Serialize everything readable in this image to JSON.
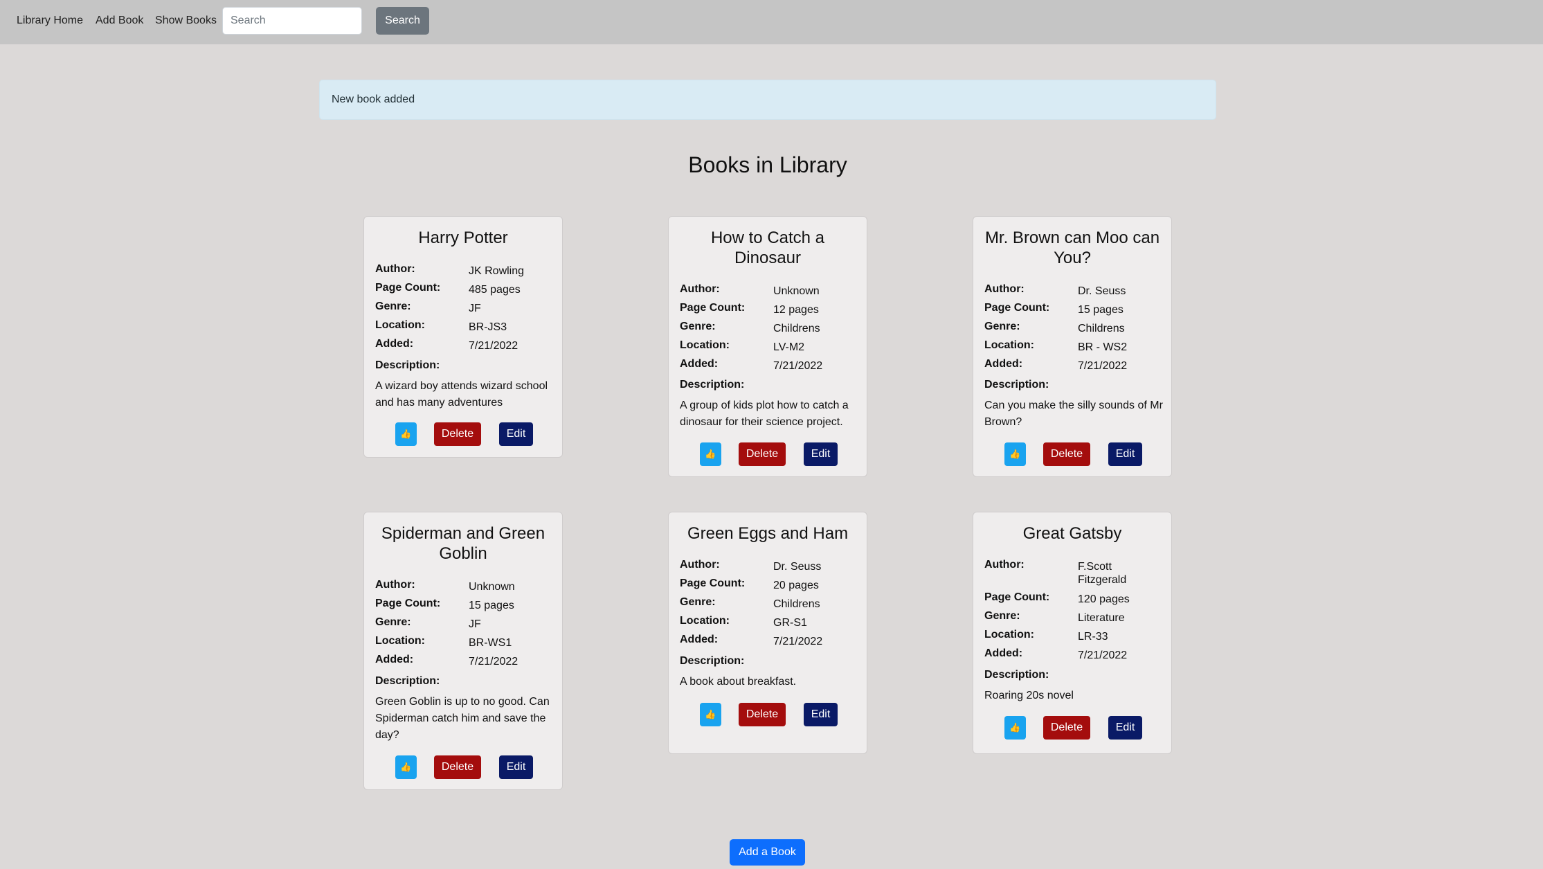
{
  "nav": {
    "home": "Library Home",
    "add": "Add Book",
    "show": "Show Books",
    "search_placeholder": "Search",
    "search_button": "Search"
  },
  "alert": {
    "message": "New book added"
  },
  "page": {
    "title": "Books in Library",
    "add_button": "Add a Book"
  },
  "labels": {
    "author": "Author:",
    "pages": "Page Count:",
    "genre": "Genre:",
    "location": "Location:",
    "added": "Added:",
    "description": "Description:",
    "like": "👍",
    "delete": "Delete",
    "edit": "Edit"
  },
  "books": [
    {
      "title": "Harry Potter",
      "author": "JK Rowling",
      "pages": "485 pages",
      "genre": "JF",
      "location": "BR-JS3",
      "added": "7/21/2022",
      "description": "A wizard boy attends wizard school and has many adventures"
    },
    {
      "title": "How to Catch a Dinosaur",
      "author": "Unknown",
      "pages": "12 pages",
      "genre": "Childrens",
      "location": "LV-M2",
      "added": "7/21/2022",
      "description": "A group of kids plot how to catch a dinosaur for their science project."
    },
    {
      "title": "Mr. Brown can Moo can You?",
      "author": "Dr. Seuss",
      "pages": "15 pages",
      "genre": "Childrens",
      "location": "BR - WS2",
      "added": "7/21/2022",
      "description": "Can you make the silly sounds of Mr Brown?"
    },
    {
      "title": "Spiderman and Green Goblin",
      "author": "Unknown",
      "pages": "15 pages",
      "genre": "JF",
      "location": "BR-WS1",
      "added": "7/21/2022",
      "description": "Green Goblin is up to no good. Can Spiderman catch him and save the day?"
    },
    {
      "title": "Green Eggs and Ham",
      "author": "Dr. Seuss",
      "pages": "20 pages",
      "genre": "Childrens",
      "location": "GR-S1",
      "added": "7/21/2022",
      "description": "A book about breakfast."
    },
    {
      "title": "Great Gatsby",
      "author": "F.Scott Fitzgerald",
      "pages": "120 pages",
      "genre": "Literature",
      "location": "LR-33",
      "added": "7/21/2022",
      "description": "Roaring 20s novel"
    }
  ]
}
